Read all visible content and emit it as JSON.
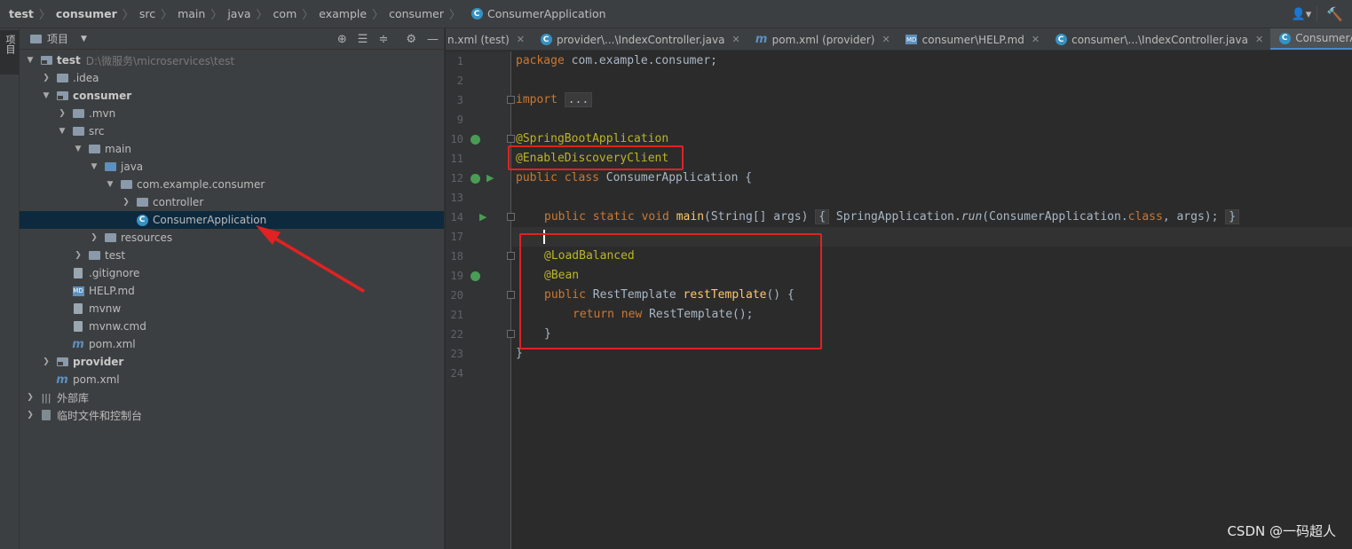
{
  "breadcrumb": [
    "test",
    "consumer",
    "src",
    "main",
    "java",
    "com",
    "example",
    "consumer",
    "ConsumerApplication"
  ],
  "stripe": {
    "tab_label": "项目"
  },
  "project_panel": {
    "title": "项目",
    "tree": [
      {
        "label": "test",
        "path": "D:\\微服务\\microservices\\test"
      },
      {
        "label": ".idea"
      },
      {
        "label": "consumer"
      },
      {
        "label": ".mvn"
      },
      {
        "label": "src"
      },
      {
        "label": "main"
      },
      {
        "label": "java"
      },
      {
        "label": "com.example.consumer"
      },
      {
        "label": "controller"
      },
      {
        "label": "ConsumerApplication"
      },
      {
        "label": "resources"
      },
      {
        "label": "test"
      },
      {
        "label": ".gitignore"
      },
      {
        "label": "HELP.md"
      },
      {
        "label": "mvnw"
      },
      {
        "label": "mvnw.cmd"
      },
      {
        "label": "pom.xml"
      },
      {
        "label": "provider"
      },
      {
        "label": "pom.xml"
      },
      {
        "label": "外部库"
      },
      {
        "label": "临时文件和控制台"
      }
    ]
  },
  "editor_tabs": [
    {
      "label": "n.xml (test)"
    },
    {
      "label": "provider\\...\\IndexController.java"
    },
    {
      "label": "pom.xml (provider)"
    },
    {
      "label": "consumer\\HELP.md"
    },
    {
      "label": "consumer\\...\\IndexController.java"
    },
    {
      "label": "ConsumerApplica"
    }
  ],
  "code": {
    "line_numbers": [
      "1",
      "2",
      "3",
      "9",
      "10",
      "11",
      "12",
      "13",
      "14",
      "17",
      "18",
      "19",
      "20",
      "21",
      "22",
      "23",
      "24"
    ],
    "l1_kw": "package",
    "l1_rest": " com.example.consumer;",
    "l3_kw": "import",
    "l3_fold": "...",
    "l10": "@SpringBootApplication",
    "l11": "@EnableDiscoveryClient",
    "l12_kw": "public class",
    "l12_rest": " ConsumerApplication {",
    "l14_kw": "public static void",
    "l14_fn": "main",
    "l14_args": "(String[] args)",
    "l14_body_a": " SpringApplication.",
    "l14_body_run": "run",
    "l14_body_b": "(ConsumerApplication.",
    "l14_body_class": "class",
    "l14_body_c": ", args); ",
    "l14_open": "{",
    "l14_close": "}",
    "l18": "@LoadBalanced",
    "l19": "@Bean",
    "l20_kw": "public",
    "l20_type": " RestTemplate ",
    "l20_fn": "restTemplate",
    "l20_rest": "() {",
    "l21_kw": "return new",
    "l21_rest": " RestTemplate();",
    "l22": "}",
    "l23": "}"
  },
  "watermark": "CSDN @一码超人",
  "colors": {
    "highlight": "#e02222",
    "keyword": "#cc7832",
    "annotation": "#bbb529",
    "method": "#ffc66d"
  }
}
